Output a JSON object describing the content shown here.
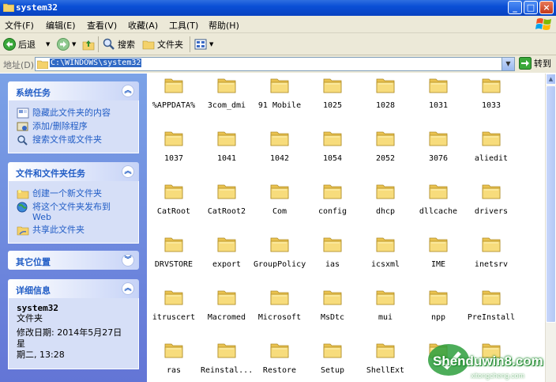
{
  "window": {
    "title": "system32"
  },
  "menu": [
    "文件(F)",
    "编辑(E)",
    "查看(V)",
    "收藏(A)",
    "工具(T)",
    "帮助(H)"
  ],
  "toolbar": {
    "back": "后退",
    "search": "搜索",
    "folders": "文件夹"
  },
  "address": {
    "label": "地址(D)",
    "value": "C:\\WINDOWS\\system32",
    "go": "转到"
  },
  "sidebar": {
    "system_tasks": {
      "title": "系统任务",
      "items": [
        "隐藏此文件夹的内容",
        "添加/删除程序",
        "搜索文件或文件夹"
      ]
    },
    "file_tasks": {
      "title": "文件和文件夹任务",
      "items": [
        "创建一个新文件夹",
        "将这个文件夹发布到 Web",
        "共享此文件夹"
      ]
    },
    "other_places": {
      "title": "其它位置"
    },
    "details": {
      "title": "详细信息",
      "name": "system32",
      "type": "文件夹",
      "modified_line1": "修改日期: 2014年5月27日星",
      "modified_line2": "期二, 13:28"
    }
  },
  "folders": [
    "%APPDATA%",
    "3com_dmi",
    "91 Mobile",
    "1025",
    "1028",
    "1031",
    "1033",
    "1037",
    "1041",
    "1042",
    "1054",
    "2052",
    "3076",
    "aliedit",
    "CatRoot",
    "CatRoot2",
    "Com",
    "config",
    "dhcp",
    "dllcache",
    "drivers",
    "DRVSTORE",
    "export",
    "GroupPolicy",
    "ias",
    "icsxml",
    "IME",
    "inetsrv",
    "itruscert",
    "Macromed",
    "Microsoft",
    "MsDtc",
    "mui",
    "npp",
    "PreInstall",
    "ras",
    "Reinstal...",
    "Restore",
    "Setup",
    "ShellExt",
    "",
    ""
  ],
  "watermark": {
    "main": "Shenduwin8.com",
    "sub": "xitongcheng.com"
  }
}
